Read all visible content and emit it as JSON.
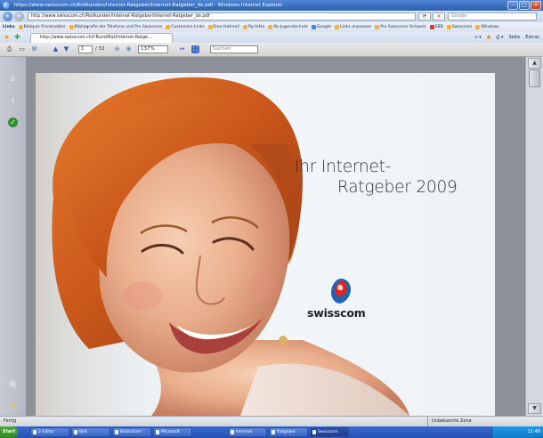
{
  "window": {
    "title": "https://www.swisscom.ch/Rollkunden/Internet-Ratgeber/Internet-Ratgeber_de.pdf - Windows Internet Explorer"
  },
  "address": {
    "url": "http://www.swisscom.ch/Rollkunden/Internet-Ratgeber/Internet-Ratgeber_de.pdf",
    "search_placeholder": "Google"
  },
  "links_bar": {
    "label": "Links",
    "items": [
      "Bildquiz Privatsektor",
      "Bibliografie der Telefone und Pro Swisscom",
      "Customize Links",
      "Free Hotmail",
      "Pp-Infos",
      "Pp-Jugendschutz",
      "Google",
      "Links anpassen",
      "Pro Swisscom Schweiz",
      "SBB",
      "Swisscom",
      "Windows"
    ]
  },
  "tab": {
    "label": "http://www.swisscom.ch/f-Rund/Rat/Internet-Ratge..."
  },
  "commands": [
    "Seite",
    "Extras"
  ],
  "pdf_toolbar": {
    "page_current": "1",
    "page_total": "/ 32",
    "zoom": "137%",
    "search_placeholder": "Suchen"
  },
  "cover": {
    "title_line1": "Ihr Internet-",
    "title_line2": "Ratgeber 2009",
    "brand": "swisscom"
  },
  "status": {
    "left": "Fertig",
    "zone": "Unbekannte Zone"
  },
  "taskbar": {
    "start": "Start",
    "tasks": [
      "2 Editor",
      "Bild",
      "Bildschirm",
      "Microsoft",
      "Internet",
      "Ratgeber",
      "Swisscom"
    ],
    "clock": "11:48"
  },
  "colors": {
    "brand_red": "#e2231a",
    "brand_blue": "#1e63b4",
    "titlebar": "#2c5fb0",
    "hair": "#d2661f"
  },
  "icons": {
    "back": "back-arrow-icon",
    "forward": "forward-arrow-icon",
    "close": "close-icon",
    "favorites": "star-icon"
  }
}
